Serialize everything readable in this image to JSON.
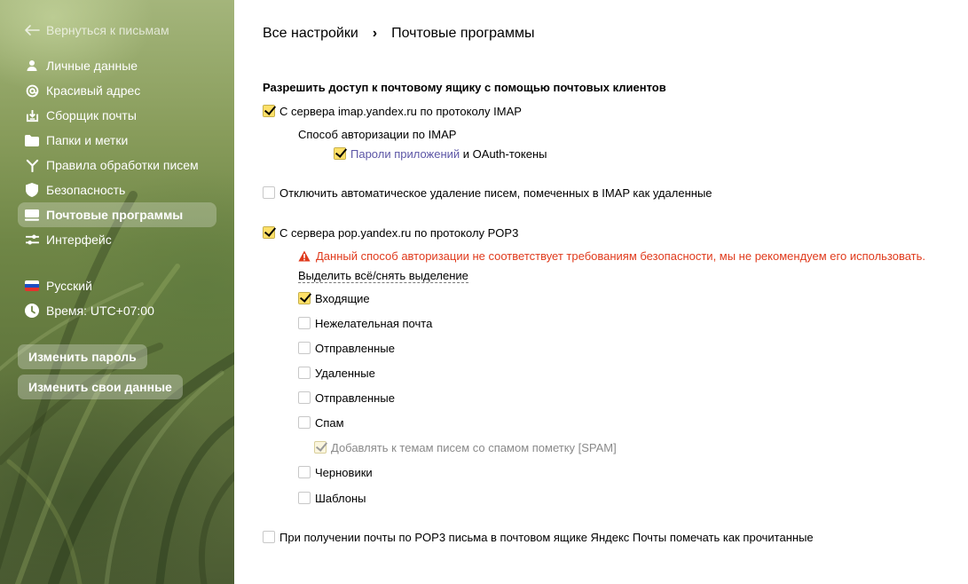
{
  "sidebar": {
    "back_label": "Вернуться к письмам",
    "items": [
      {
        "label": "Личные данные",
        "icon": "person-icon"
      },
      {
        "label": "Красивый адрес",
        "icon": "at-sign-icon"
      },
      {
        "label": "Сборщик почты",
        "icon": "inbox-download-icon"
      },
      {
        "label": "Папки и метки",
        "icon": "folder-icon"
      },
      {
        "label": "Правила обработки писем",
        "icon": "fork-rules-icon"
      },
      {
        "label": "Безопасность",
        "icon": "shield-icon"
      },
      {
        "label": "Почтовые программы",
        "icon": "mail-client-icon",
        "active": true
      },
      {
        "label": "Интерфейс",
        "icon": "sliders-icon"
      }
    ],
    "language_label": "Русский",
    "timezone_label": "Время: UTC+07:00",
    "change_password_label": "Изменить пароль",
    "change_data_label": "Изменить свои данные"
  },
  "breadcrumb": {
    "root": "Все настройки",
    "separator": "›",
    "current": "Почтовые программы"
  },
  "main": {
    "section_title": "Разрешить доступ к почтовому ящику с помощью почтовых клиентов",
    "imap": {
      "label": "С сервера imap.yandex.ru по протоколу IMAP",
      "checked": true,
      "auth_heading": "Способ авторизации по IMAP",
      "auth_link": "Пароли приложений",
      "auth_rest": " и OAuth-токены",
      "auth_checked": true
    },
    "disable_autodelete": {
      "label": "Отключить автоматическое удаление писем, помеченных в IMAP как удаленные",
      "checked": false
    },
    "pop3": {
      "label": "С сервера pop.yandex.ru по протоколу POP3",
      "checked": true,
      "warning": "Данный способ авторизации не соответствует требованиям безопасности, мы не рекомендуем его использовать.",
      "select_all": "Выделить всё/снять выделение",
      "folders": [
        {
          "label": "Входящие",
          "checked": true
        },
        {
          "label": "Нежелательная почта",
          "checked": false
        },
        {
          "label": "Отправленные",
          "checked": false
        },
        {
          "label": "Удаленные",
          "checked": false
        },
        {
          "label": "Отправленные",
          "checked": false
        },
        {
          "label": "Спам",
          "checked": false
        }
      ],
      "spam_tag": {
        "label": "Добавлять к темам писем со спамом пометку [SPAM]",
        "checked": true,
        "disabled": true
      },
      "folders_after": [
        {
          "label": "Черновики",
          "checked": false
        },
        {
          "label": "Шаблоны",
          "checked": false
        }
      ]
    },
    "mark_read": {
      "label": "При получении почты по POP3 письма в почтовом ящике Яндекс Почты помечать как прочитанные",
      "checked": false
    }
  },
  "colors": {
    "accent_yellow": "#ffdb4d",
    "warning_red": "#e03a1c",
    "link_purple": "#5c56a6"
  }
}
